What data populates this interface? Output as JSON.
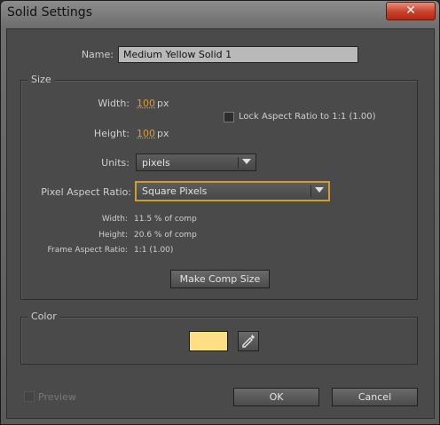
{
  "window": {
    "title": "Solid Settings",
    "close_glyph": "✕"
  },
  "name": {
    "label": "Name:",
    "value": "Medium Yellow Solid 1"
  },
  "size": {
    "group_title": "Size",
    "width_label": "Width:",
    "width_value": "100",
    "width_unit": "px",
    "height_label": "Height:",
    "height_value": "100",
    "height_unit": "px",
    "lock_aspect_label": "Lock Aspect Ratio to 1:1 (1.00)",
    "lock_aspect_checked": false,
    "units_label": "Units:",
    "units_value": "pixels",
    "pixel_aspect_label": "Pixel Aspect Ratio:",
    "pixel_aspect_value": "Square Pixels",
    "info": {
      "width_label": "Width:",
      "width_value": "11.5 % of comp",
      "height_label": "Height:",
      "height_value": "20.6 % of comp",
      "frame_aspect_label": "Frame Aspect Ratio:",
      "frame_aspect_value": "1:1 (1.00)"
    },
    "make_comp_size_label": "Make Comp Size"
  },
  "color": {
    "group_title": "Color",
    "swatch_hex": "#FFDE85",
    "eyedropper_icon": "eyedropper-icon"
  },
  "footer": {
    "preview_label": "Preview",
    "preview_checked": false,
    "ok_label": "OK",
    "cancel_label": "Cancel"
  }
}
